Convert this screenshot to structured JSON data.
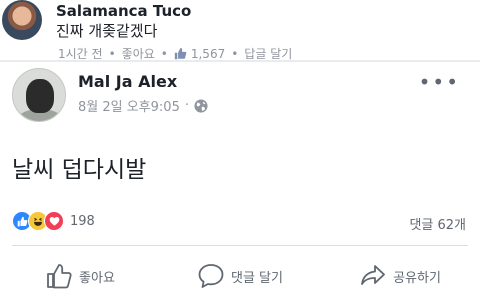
{
  "comment": {
    "author": "Salamanca Tuco",
    "text": "진짜 개좆같겠다",
    "time": "1시간 전",
    "like_label": "좋아요",
    "like_count": "1,567",
    "reply_label": "답글 달기"
  },
  "post": {
    "author": "Mal Ja Alex",
    "timestamp": "8월 2일 오후9:05",
    "body": "날씨 덥다시발",
    "reaction_count": "198",
    "comment_count": "댓글 62개",
    "icons": {
      "globe": "globe-icon",
      "more": "more-icon",
      "reactions": [
        "like-reaction-icon",
        "haha-reaction-icon",
        "love-reaction-icon"
      ]
    }
  },
  "actions": {
    "like_label": "좋아요",
    "comment_label": "댓글 달기",
    "share_label": "공유하기"
  },
  "colors": {
    "like_blue": "#2d88ff",
    "haha_yellow": "#f7c73b",
    "love_red": "#f33e58",
    "meta_gray": "#90949c"
  }
}
